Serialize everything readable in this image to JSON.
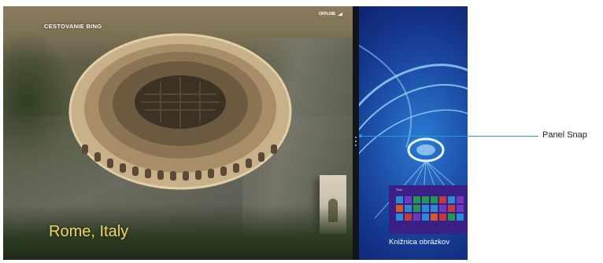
{
  "left_app": {
    "title": "CESTOVANIE BING",
    "status": "OFFLINE",
    "location": "Rome, Italy"
  },
  "right_panel": {
    "start_label": "Štart",
    "caption": "Knižnica obrázkov",
    "tile_colors": [
      "#2a8ad6",
      "#6c3bbf",
      "#1f9a4e",
      "#1f9a4e",
      "#1f9a4e",
      "#c23b3b",
      "#2a8ad6",
      "#6c3bbf",
      "#d25a2a",
      "#2a8ad6",
      "#1f9a4e",
      "#2a8ad6",
      "#2a8ad6",
      "#6c3bbf",
      "#c23b3b",
      "#6c3bbf",
      "#2a8ad6",
      "#c23b3b",
      "#6c3bbf",
      "#2a8ad6",
      "#d25a2a",
      "#c23b3b",
      "#1f9a4e",
      "#2a8ad6"
    ]
  },
  "callout": {
    "label": "Panel Snap"
  },
  "colors": {
    "accent": "#1e9dd9",
    "location_text": "#f2d463",
    "panel_blue": "#1d4ea8"
  }
}
